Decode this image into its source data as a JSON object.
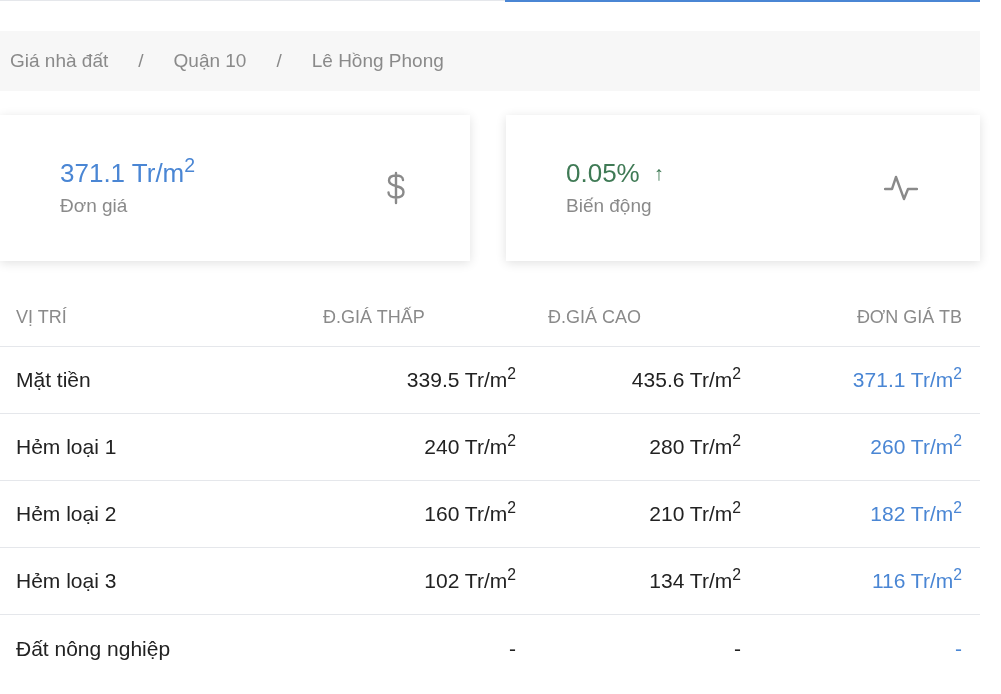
{
  "breadcrumb": [
    "Giá nhà đất",
    "Quận 10",
    "Lê Hồng Phong"
  ],
  "breadcrumb_separator": "/",
  "stats": [
    {
      "kind": "price",
      "value": "371.1 Tr/m$^{2}$",
      "label": "Đơn giá"
    },
    {
      "kind": "change",
      "value": "0.05%",
      "arrow": "↑",
      "label": "Biến động"
    }
  ],
  "table": {
    "columns": [
      "VỊ TRÍ",
      "Đ.GIÁ THẤP",
      "Đ.GIÁ CAO",
      "ĐƠN GIÁ TB"
    ],
    "rows": [
      [
        "Mặt tiền",
        "339.5 Tr/m$^{2}$",
        "435.6 Tr/m$^{2}$",
        "371.1 Tr/m$^{2}$"
      ],
      [
        "Hẻm loại 1",
        "240 Tr/m$^{2}$",
        "280 Tr/m$^{2}$",
        "260 Tr/m$^{2}$"
      ],
      [
        "Hẻm loại 2",
        "160 Tr/m$^{2}$",
        "210 Tr/m$^{2}$",
        "182 Tr/m$^{2}$"
      ],
      [
        "Hẻm loại 3",
        "102 Tr/m$^{2}$",
        "134 Tr/m$^{2}$",
        "116 Tr/m$^{2}$"
      ],
      [
        "Đất nông nghiệp",
        "-",
        "-",
        "-"
      ]
    ]
  }
}
